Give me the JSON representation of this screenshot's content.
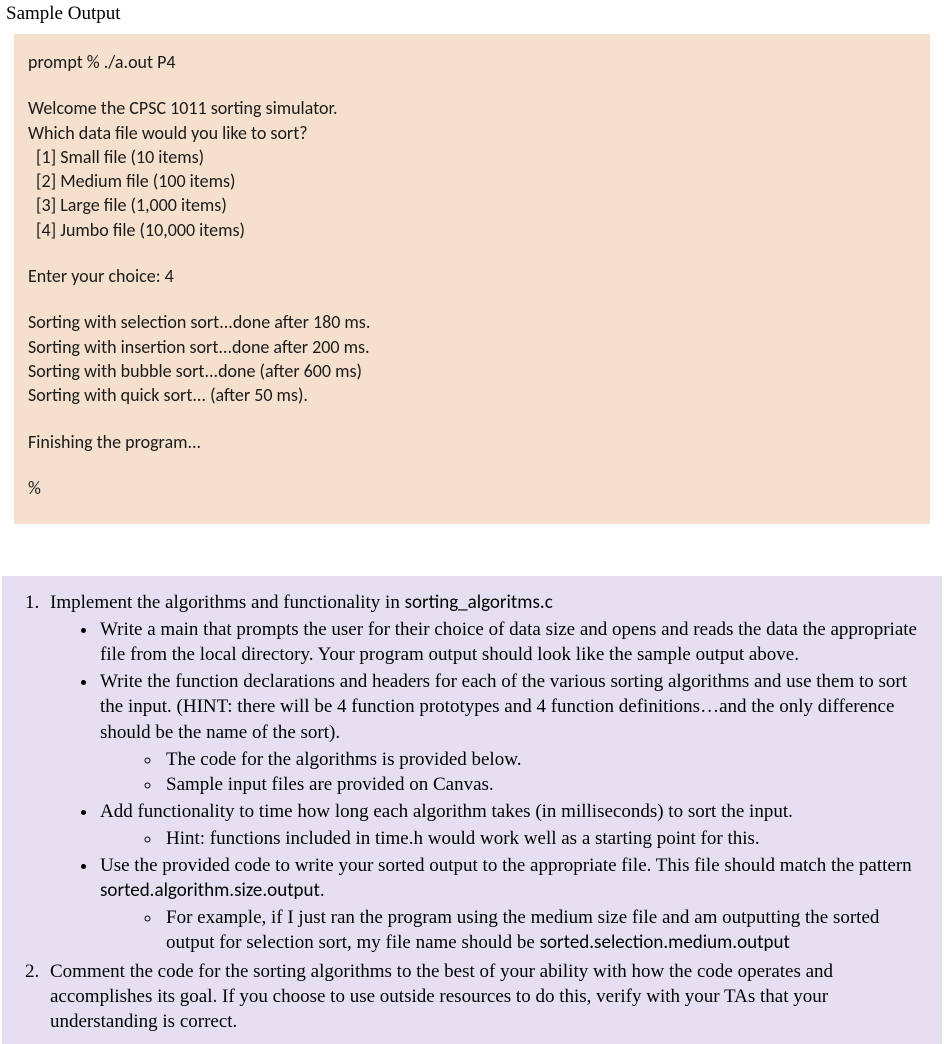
{
  "title": "Sample Output",
  "output": {
    "prompt": "prompt % ./a.out P4",
    "welcome": "Welcome the CPSC 1011 sorting simulator.",
    "question": "Which data file would you like to sort?",
    "opt1": "[1] Small file (10 items)",
    "opt2": "[2] Medium file (100 items)",
    "opt3": "[3] Large file (1,000 items)",
    "opt4": "[4] Jumbo file (10,000 items)",
    "choice": "Enter your choice:  4",
    "selsort": "Sorting with selection sort...done after 180 ms.",
    "inssort": "Sorting with insertion sort...done after 200 ms.",
    "bubsort": "Sorting with bubble sort...done (after 600 ms)",
    "qksort": "Sorting with quick sort... (after 50 ms).",
    "finish": "Finishing the program...",
    "endprompt": "%"
  },
  "instr": {
    "item1_lead": "Implement the algorithms and functionality in ",
    "item1_file": "sorting_algoritms.c",
    "b1": "Write a main that prompts the user for their choice of data size and opens and reads the data the appropriate file from the local directory. Your program output should look like the sample output above.",
    "b2": "Write the function declarations and headers for each of the various sorting algorithms and use them to sort the input. (HINT: there will be 4 function prototypes and 4 function definitions…and the only difference should be the name of the sort).",
    "b2s1": "The code for the algorithms is provided below.",
    "b2s2": "Sample input files are provided on Canvas.",
    "b3": "Add functionality to time how long each algorithm takes (in milliseconds) to sort the input.",
    "b3s1": "Hint: functions included in time.h would work well as a starting point for this.",
    "b4_lead": "Use the provided code to write your sorted output to the appropriate file. This file should match the pattern ",
    "b4_pat": "sorted.algorithm.size.output",
    "b4_dot": ".",
    "b4s1_lead": "For example, if I just ran the program using the medium size file and am outputting the sorted output for selection sort, my file name should be ",
    "b4s1_ex": "sorted.selection.medium.output",
    "item2": "Comment the code for the sorting algorithms to the best of your ability with how the code operates and accomplishes its goal. If you choose to use outside resources to do this, verify with your TAs that your understanding is correct."
  }
}
